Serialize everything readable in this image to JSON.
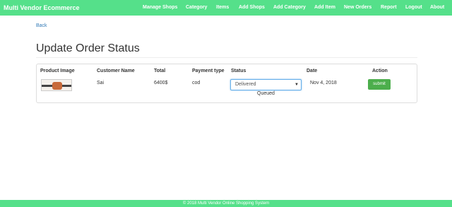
{
  "navbar": {
    "brand": "Multi Vendor Ecommerce",
    "items": [
      "Manage Shops",
      "Category",
      "Items",
      "Add Shops",
      "Add Category",
      "Add Item",
      "New Orders",
      "Report",
      "Logout",
      "About"
    ]
  },
  "back": "Back",
  "page_title": "Update Order Status",
  "table": {
    "headers": [
      "Product Image",
      "Customer Name",
      "Total",
      "Payment type",
      "Status",
      "Date",
      "Action"
    ],
    "row": {
      "customer": "Sai",
      "total": "6400$",
      "payment": "cod",
      "status_selected": "Delivered",
      "date": "Nov 4, 2018",
      "action": "submit"
    },
    "status_options_visible": [
      "Queued"
    ]
  },
  "footer": "© 2018 Multi Vendor Online Shopping System",
  "colors": {
    "nav": "#55e08a",
    "submit": "#4cae4c",
    "link": "#337ab7"
  }
}
